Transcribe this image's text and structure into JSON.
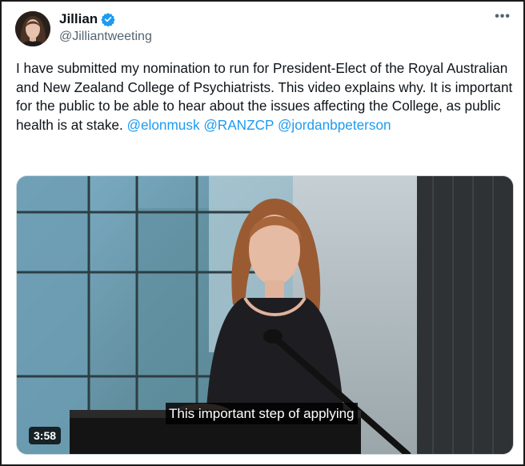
{
  "author": {
    "name": "Jillian",
    "handle": "@Jilliantweeting"
  },
  "icons": {
    "verified": "verified-badge-icon",
    "more": "more-options-icon"
  },
  "tweet": {
    "text": "I have submitted my nomination to run for President-Elect of the Royal Australian and New Zealand College of Psychiatrists. This video explains why. It is important for the public to be able to hear about the issues affecting the College, as public health is at stake. ",
    "mentions": [
      "@elonmusk",
      "@RANZCP",
      "@jordanbpeterson"
    ]
  },
  "video": {
    "caption": "This important step of applying",
    "duration": "3:58"
  },
  "colors": {
    "link": "#1d9bf0",
    "verified": "#1d9bf0",
    "text": "#0f1419",
    "secondary": "#536471"
  }
}
